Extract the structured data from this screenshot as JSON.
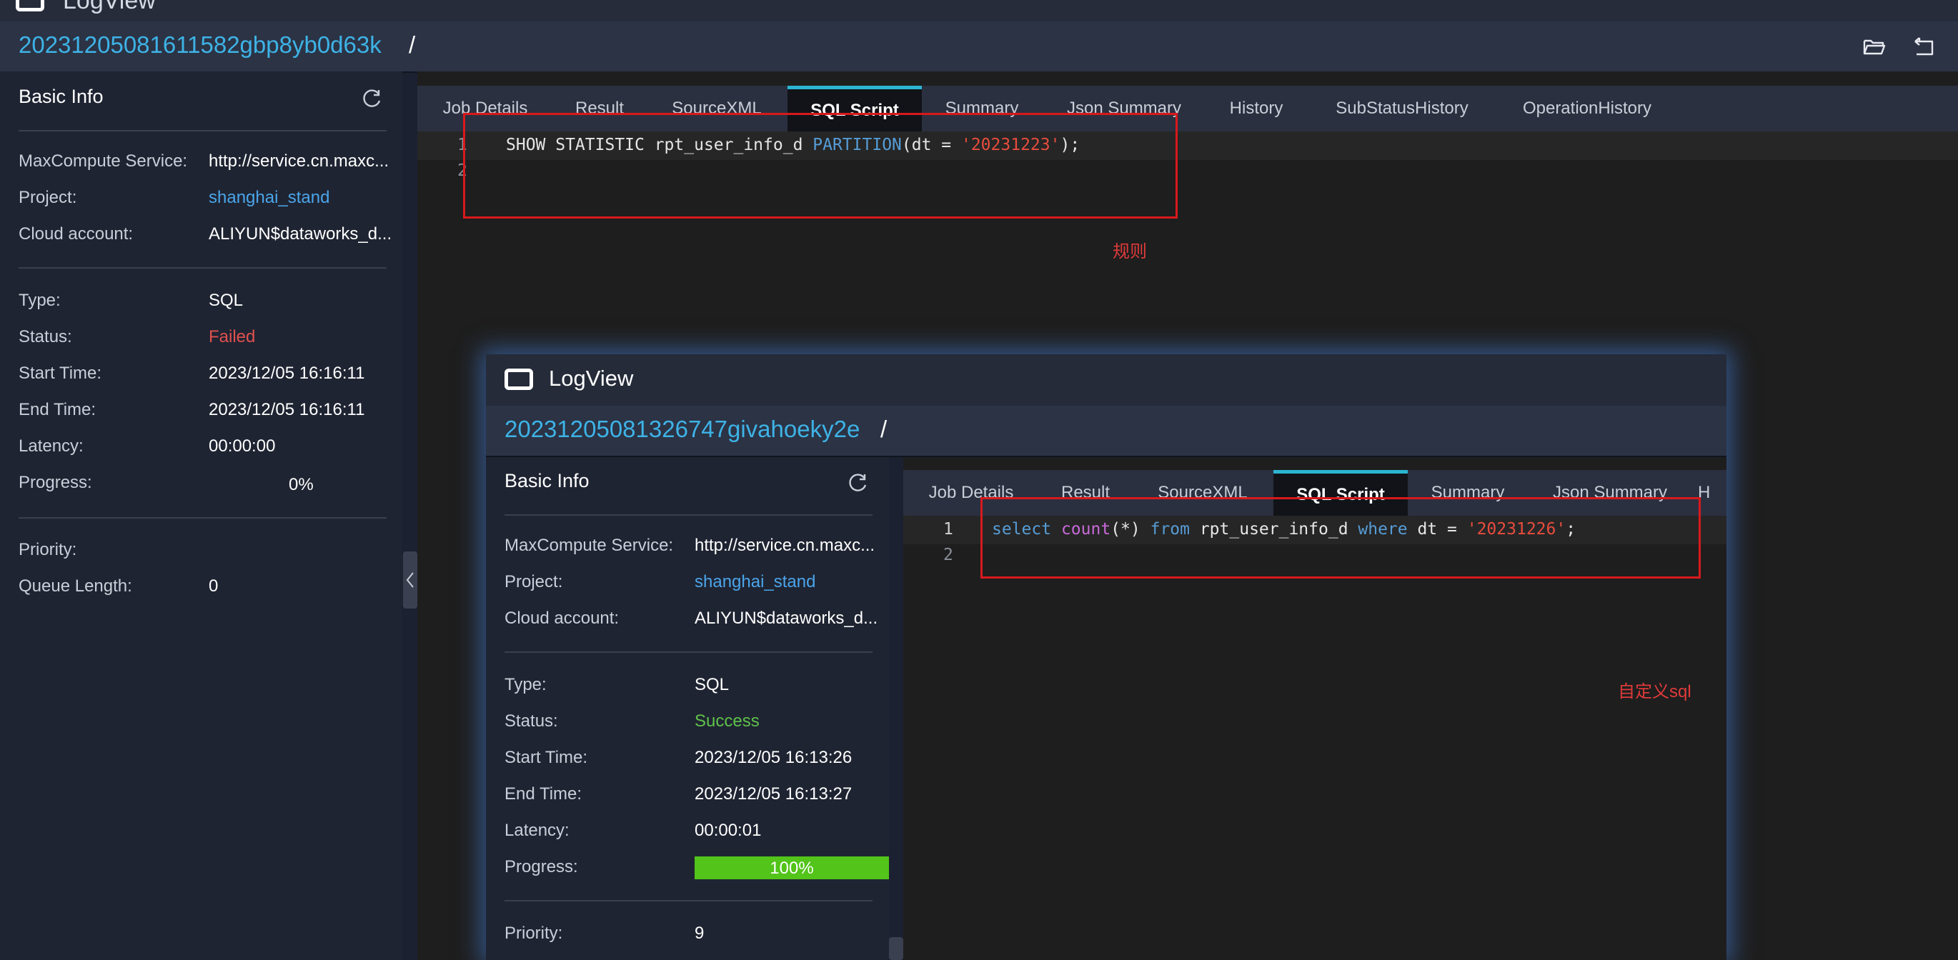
{
  "app": {
    "title": "LogView"
  },
  "job": {
    "id": "20231205081611582gbp8yb0d63k",
    "slash": "/"
  },
  "basic_info": {
    "heading": "Basic Info",
    "rows1": [
      {
        "label": "MaxCompute Service:",
        "value": "http://service.cn.maxc..."
      },
      {
        "label": "Project:",
        "value": "shanghai_stand"
      },
      {
        "label": "Cloud account:",
        "value": "ALIYUN$dataworks_d..."
      }
    ],
    "rows2": [
      {
        "label": "Type:",
        "value": "SQL"
      },
      {
        "label": "Status:",
        "value": "Failed"
      },
      {
        "label": "Start Time:",
        "value": "2023/12/05 16:16:11"
      },
      {
        "label": "End Time:",
        "value": "2023/12/05 16:16:11"
      },
      {
        "label": "Latency:",
        "value": "00:00:00"
      },
      {
        "label": "Progress:",
        "value": "0%"
      }
    ],
    "rows3": [
      {
        "label": "Priority:",
        "value": ""
      },
      {
        "label": "Queue Length:",
        "value": "0"
      }
    ]
  },
  "tabs": [
    "Job Details",
    "Result",
    "SourceXML",
    "SQL Script",
    "Summary",
    "Json Summary",
    "History",
    "SubStatusHistory",
    "OperationHistory"
  ],
  "active_tab": "SQL Script",
  "code": {
    "line_numbers": [
      "1",
      "2"
    ],
    "line1": {
      "a": "SHOW STATISTIC rpt_user_info_d ",
      "b": "PARTITION",
      "c": "(dt = ",
      "d": "'20231223'",
      "e": ");"
    }
  },
  "annotation_top": "规则",
  "inset": {
    "title": "LogView",
    "job": {
      "id": "20231205081326747givahoeky2e",
      "slash": "/"
    },
    "basic_info": {
      "heading": "Basic Info",
      "rows1": [
        {
          "label": "MaxCompute Service:",
          "value": "http://service.cn.maxc..."
        },
        {
          "label": "Project:",
          "value": "shanghai_stand"
        },
        {
          "label": "Cloud account:",
          "value": "ALIYUN$dataworks_d..."
        }
      ],
      "rows2": [
        {
          "label": "Type:",
          "value": "SQL"
        },
        {
          "label": "Status:",
          "value": "Success"
        },
        {
          "label": "Start Time:",
          "value": "2023/12/05 16:13:26"
        },
        {
          "label": "End Time:",
          "value": "2023/12/05 16:13:27"
        },
        {
          "label": "Latency:",
          "value": "00:00:01"
        },
        {
          "label": "Progress:",
          "value": "100%"
        }
      ],
      "rows3": [
        {
          "label": "Priority:",
          "value": "9"
        }
      ]
    },
    "progress_fraction": 1.0,
    "tabs": [
      "Job Details",
      "Result",
      "SourceXML",
      "SQL Script",
      "Summary",
      "Json Summary",
      "H"
    ],
    "code": {
      "line_numbers": [
        "1",
        "2"
      ],
      "line1": {
        "a": "select",
        "b": " ",
        "c": "count",
        "d": "(*) ",
        "e": "from",
        "f": " rpt_user_info_d ",
        "g": "where",
        "h": " dt = ",
        "i": "'20231226'",
        "j": ";"
      }
    },
    "annotation": "自定义sql"
  },
  "colors": {
    "accent": "#2bb5d2",
    "link": "#4aa5ea",
    "failed": "#e0514f",
    "success": "#5ec24a",
    "progress": "#52c41a",
    "annotation": "#d8191c"
  }
}
